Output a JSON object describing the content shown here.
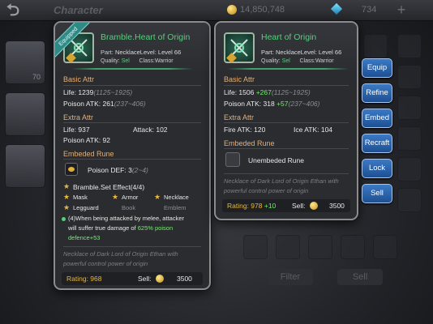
{
  "topbar": {
    "title": "Character",
    "gold": "14,850,748",
    "gems": "734",
    "add": "+",
    "back": "⮌"
  },
  "background": {
    "hero_levels": [
      "70",
      "",
      ""
    ],
    "bottom_buttons": [
      "Filter",
      "Sell"
    ]
  },
  "left_panel": {
    "badge": "Equipped",
    "name": "Bramble.Heart of Origin",
    "part_label": "Part:",
    "part": "Necklace",
    "level_label": "Level:",
    "level": "Level 66",
    "quality_label": "Quality:",
    "quality": "Sel",
    "class_label": "Class:",
    "class": "Warrior",
    "basic_title": "Basic Attr",
    "life": "Life: 1239",
    "life_range": "(1125~1925)",
    "poison": "Poison ATK: 261",
    "poison_range": "(237~406)",
    "extra_title": "Extra Attr",
    "extra_life": "Life: 937",
    "extra_attack": "Attack: 102",
    "extra_poison": "Poison ATK: 92",
    "rune_title": "Embeded Rune",
    "rune": "Poison DEF: 3",
    "rune_range": "(2~4)",
    "set_title": "Bramble.Set Effect(4/4)",
    "set_items": [
      "Mask",
      "Armor",
      "Necklace",
      "Legguard",
      "Book",
      "Emblem"
    ],
    "set_effect_1": "(4)When being attacked by melee, attacker",
    "set_effect_2": "will suffer true damage of ",
    "set_effect_2b": "625% poison",
    "set_effect_3": "defence+53",
    "description": "Necklace of Dark Lord of Origin Ethan with powerful control power of origin",
    "rating": "Rating: 968",
    "sell_label": "Sell:",
    "sell_value": "3500"
  },
  "right_panel": {
    "name": "Heart of Origin",
    "part_label": "Part:",
    "part": "Necklace",
    "level_label": "Level:",
    "level": "Level 66",
    "quality_label": "Quality:",
    "quality": "Sel",
    "class_label": "Class:",
    "class": "Warrior",
    "basic_title": "Basic Attr",
    "life": "Life: 1506",
    "life_delta": "+267",
    "life_range": "(1125~1925)",
    "poison": "Poison ATK: 318",
    "poison_delta": "+57",
    "poison_range": "(237~406)",
    "extra_title": "Extra Attr",
    "extra_fire": "Fire ATK: 120",
    "extra_ice": "Ice ATK: 104",
    "rune_title": "Embeded Rune",
    "rune_empty": "Unembeded Rune",
    "description": "Necklace of Dark Lord of Origin Ethan with powerful control power of origin",
    "rating": "Rating: 978",
    "rating_delta": "+10",
    "sell_label": "Sell:",
    "sell_value": "3500"
  },
  "actions": [
    "Equip",
    "Refine",
    "Embed",
    "Recraft",
    "Lock",
    "Sell"
  ],
  "colors": {
    "item_name": "#55d07a",
    "section": "#e0b07a",
    "button": "#2a62ad",
    "rating": "#e6b83e"
  }
}
